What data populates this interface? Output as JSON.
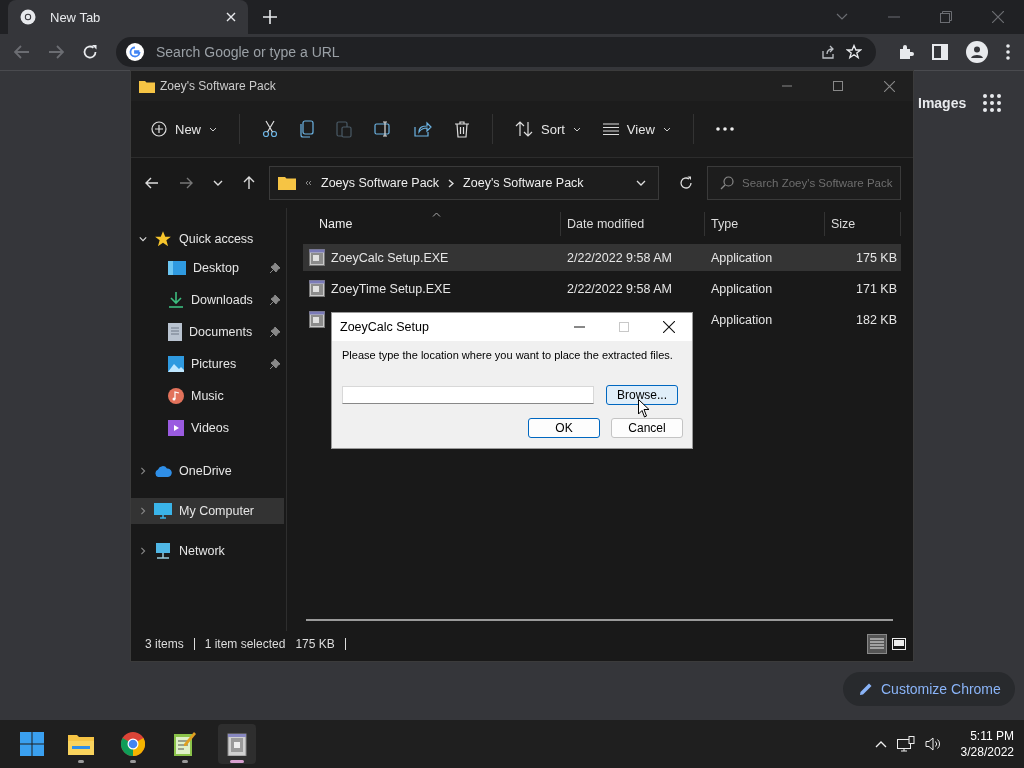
{
  "browser": {
    "tabs": [
      {
        "title": "New Tab",
        "selected": true
      }
    ],
    "nav": {
      "back_disabled": true,
      "forward_disabled": true
    },
    "address": {
      "placeholder": "Search Google or type a URL"
    },
    "page": {
      "images_link": "Images",
      "customize_button": "Customize Chrome"
    }
  },
  "explorer": {
    "title": "Zoey's Software Pack",
    "toolbar": {
      "new": "New",
      "sort": "Sort",
      "view": "View",
      "paste_disabled": true
    },
    "nav": {
      "forward_disabled": true
    },
    "breadcrumb": [
      "Zoeys Software Pack",
      "Zoey's Software Pack"
    ],
    "search": {
      "placeholder": "Search Zoey's Software Pack"
    },
    "sidebar": [
      {
        "label": "Quick access",
        "expanded": true,
        "selected": false,
        "children": [
          {
            "label": "Desktop",
            "pinned": true
          },
          {
            "label": "Downloads",
            "pinned": true
          },
          {
            "label": "Documents",
            "pinned": true
          },
          {
            "label": "Pictures",
            "pinned": true
          },
          {
            "label": "Music",
            "pinned": false
          },
          {
            "label": "Videos",
            "pinned": false
          }
        ]
      },
      {
        "label": "OneDrive",
        "expanded": false,
        "selected": false
      },
      {
        "label": "My Computer",
        "expanded": false,
        "selected": true
      },
      {
        "label": "Network",
        "expanded": false,
        "selected": false
      }
    ],
    "columns": [
      {
        "label": "Name",
        "sorted": true
      },
      {
        "label": "Date modified",
        "sorted": false
      },
      {
        "label": "Type",
        "sorted": false
      },
      {
        "label": "Size",
        "sorted": false
      }
    ],
    "rows": [
      {
        "name": "ZoeyCalc Setup.EXE",
        "date": "2/22/2022 9:58 AM",
        "type": "Application",
        "size": "175 KB",
        "selected": true
      },
      {
        "name": "ZoeyTime Setup.EXE",
        "date": "2/22/2022 9:58 AM",
        "type": "Application",
        "size": "171 KB",
        "selected": false
      },
      {
        "type": "Application",
        "size": "182 KB",
        "selected": false
      }
    ],
    "status": {
      "items": "3 items",
      "selection": "1 item selected",
      "size": "175 KB"
    },
    "views": [
      {
        "selected": true
      },
      {
        "selected": false
      }
    ]
  },
  "dialog": {
    "title": "ZoeyCalc Setup",
    "message": "Please type the location where you want to place the extracted files.",
    "maximize_disabled": true,
    "browse": {
      "label": "Browse...",
      "hovered": true
    },
    "buttons": [
      {
        "label": "OK",
        "default": true
      },
      {
        "label": "Cancel",
        "default": false
      }
    ]
  },
  "taskbar": {
    "apps": [
      {
        "running": true,
        "active": false
      },
      {
        "running": true,
        "active": false
      },
      {
        "running": true,
        "active": false
      },
      {
        "running": true,
        "active": true
      }
    ],
    "time": "5:11 PM",
    "date": "3/28/2022"
  }
}
